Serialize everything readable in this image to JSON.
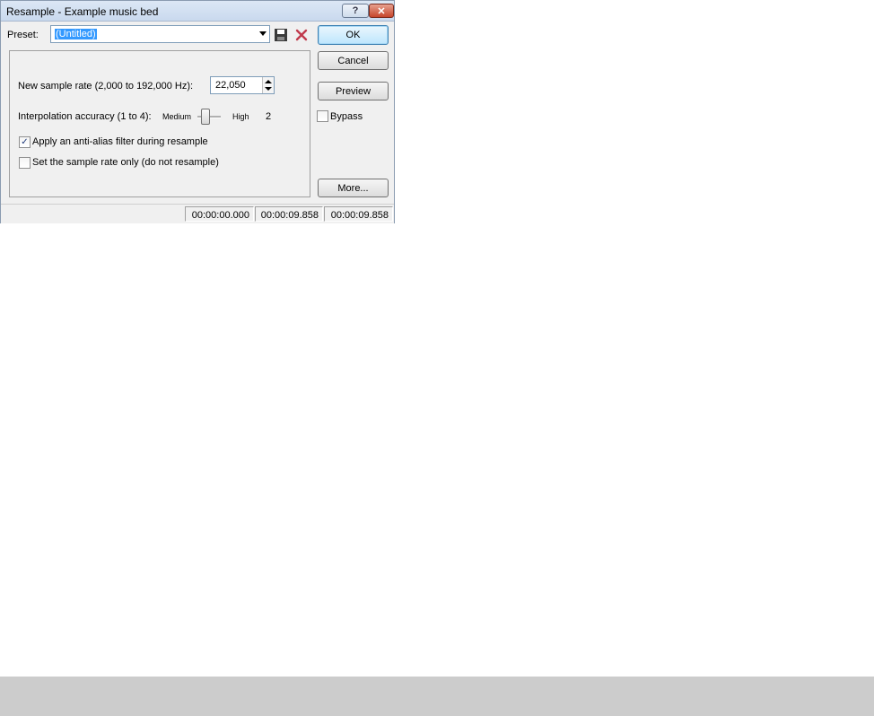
{
  "window": {
    "title": "Resample - Example music bed",
    "help_button": "?",
    "close_button": "✕"
  },
  "preset": {
    "label": "Preset:",
    "value": "(Untitled)"
  },
  "buttons": {
    "ok": "OK",
    "cancel": "Cancel",
    "preview": "Preview",
    "more": "More..."
  },
  "bypass": {
    "label": "Bypass",
    "checked": false
  },
  "settings": {
    "sample_rate_label": "New sample rate (2,000 to 192,000 Hz):",
    "sample_rate_value": "22,050",
    "interpolation_label": "Interpolation accuracy (1 to 4):",
    "interpolation_min_label": "Medium",
    "interpolation_max_label": "High",
    "interpolation_value": "2",
    "anti_alias_label": "Apply an anti-alias filter during resample",
    "anti_alias_checked": true,
    "rate_only_label": "Set the sample rate only (do not resample)",
    "rate_only_checked": false
  },
  "status": {
    "start": "00:00:00.000",
    "end": "00:00:09.858",
    "length": "00:00:09.858"
  },
  "icons": {
    "save": "save-icon",
    "delete": "delete-icon"
  },
  "colors": {
    "selection": "#3399ff",
    "delete_red": "#c0394b"
  }
}
